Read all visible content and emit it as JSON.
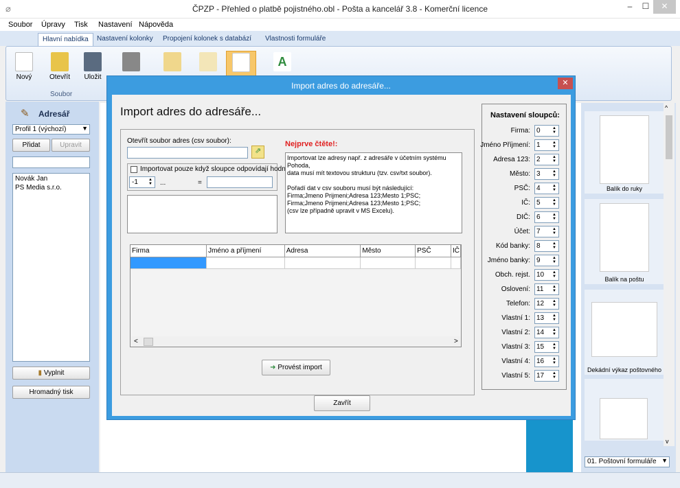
{
  "window": {
    "title": "ČPZP - Přehled o platbě pojistného.obl - Pošta a kancelář 3.8 - Komerční licence"
  },
  "menu": [
    "Soubor",
    "Úpravy",
    "Tisk",
    "Nastavení",
    "Nápověda"
  ],
  "ribbon_tabs": [
    "Hlavní nabídka",
    "Nastavení kolonky",
    "Propojení kolonek s databází",
    "Vlastnosti formuláře"
  ],
  "ribbon": {
    "new": "Nový",
    "open": "Otevřít",
    "save": "Uložit",
    "group_label": "Soubor"
  },
  "address_book": {
    "title": "Adresář",
    "profile": "Profil 1 (výchozí)",
    "add": "Přidat",
    "edit": "Upravit",
    "search_value": "",
    "contacts": [
      "Novák Jan",
      "PS Media s.r.o."
    ],
    "fill": "Vyplnit",
    "bulk_print": "Hromadný tisk"
  },
  "templates": {
    "items": [
      "Balík do ruky",
      "Balík na poštu",
      "Dekádní výkaz poštovného"
    ],
    "selected": "01. Poštovní formuláře"
  },
  "dialog": {
    "title": "Import adres do adresáře...",
    "heading": "Import adres do adresáře...",
    "open_file_label": "Otevřít soubor adres (csv soubor):",
    "file_value": "",
    "filter_label": "Importovat pouze když sloupce odpovídají hodnotě:",
    "filter_column": "-1",
    "filter_dots": "...",
    "filter_eq": "=",
    "filter_value": "",
    "read_first": "Nejprve čtěte!:",
    "info_lines": [
      "Importovat lze adresy např. z adresáře v účetním systému Pohoda,",
      "data musí mít textovou strukturu (tzv. csv/txt soubor).",
      "",
      "Pořadí dat v csv souboru musí být následující:",
      "Firma;Jmeno Prijmeni;Adresa 123;Mesto 1;PSC;",
      "Firma;Jmeno Prijmeni;Adresa 123;Mesto 1;PSC;",
      "(csv lze případně upravit v MS Excelu)."
    ],
    "grid_headers": [
      "Firma",
      "Jméno a příjmení",
      "Adresa",
      "Město",
      "PSČ",
      "IČ"
    ],
    "import_button": "Provést import",
    "close_button": "Zavřít",
    "columns_title": "Nastavení sloupců:",
    "columns": [
      {
        "label": "Firma:",
        "value": "0"
      },
      {
        "label": "Jméno Příjmení:",
        "value": "1"
      },
      {
        "label": "Adresa 123:",
        "value": "2"
      },
      {
        "label": "Město:",
        "value": "3"
      },
      {
        "label": "PSČ:",
        "value": "4"
      },
      {
        "label": "IČ:",
        "value": "5"
      },
      {
        "label": "DIČ:",
        "value": "6"
      },
      {
        "label": "Účet:",
        "value": "7"
      },
      {
        "label": "Kód banky:",
        "value": "8"
      },
      {
        "label": "Jméno banky:",
        "value": "9"
      },
      {
        "label": "Obch. rejst.",
        "value": "10"
      },
      {
        "label": "Oslovení:",
        "value": "11"
      },
      {
        "label": "Telefon:",
        "value": "12"
      },
      {
        "label": "Vlastní 1:",
        "value": "13"
      },
      {
        "label": "Vlastní 2:",
        "value": "14"
      },
      {
        "label": "Vlastní 3:",
        "value": "15"
      },
      {
        "label": "Vlastní 4:",
        "value": "16"
      },
      {
        "label": "Vlastní 5:",
        "value": "17"
      }
    ]
  },
  "colors": {
    "dialog_frame": "#3c9ce0",
    "warning": "#e02020",
    "selection": "#3399ff",
    "close": "#c75050"
  }
}
